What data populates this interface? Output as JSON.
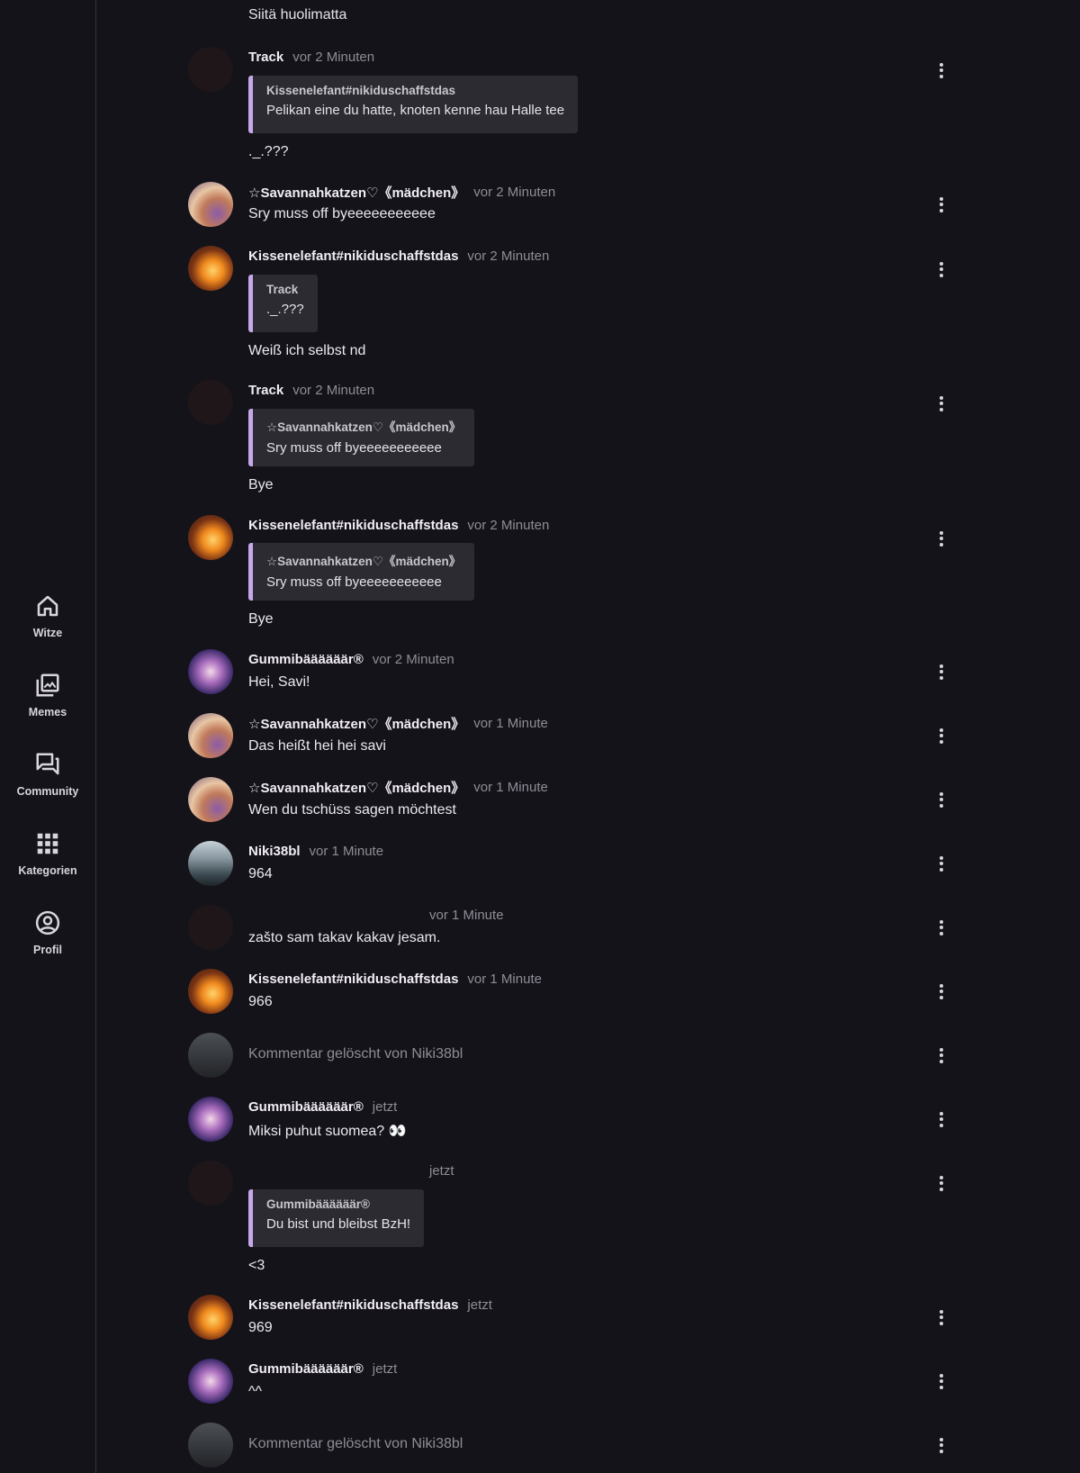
{
  "nav": {
    "items": [
      {
        "label": "Witze",
        "icon": "home-icon"
      },
      {
        "label": "Memes",
        "icon": "photo-library-icon"
      },
      {
        "label": "Community",
        "icon": "forum-icon"
      },
      {
        "label": "Kategorien",
        "icon": "apps-grid-icon"
      },
      {
        "label": "Profil",
        "icon": "account-circle-icon"
      }
    ]
  },
  "feed": {
    "top_fragment": "Siitä huolimatta",
    "comments": [
      {
        "author": "Track",
        "time": "vor 2 Minuten",
        "quote": {
          "author": "Kissenelefant#nikiduschaffstdas",
          "text": "Pelikan eine du hatte, knoten kenne hau Halle tee"
        },
        "text": "._.???"
      },
      {
        "author": "☆Savannahkatzen♡《mädchen》",
        "time": "vor 2 Minuten",
        "text": "Sry muss off byeeeeeeeeeee"
      },
      {
        "author": "Kissenelefant#nikiduschaffstdas",
        "time": "vor 2 Minuten",
        "quote": {
          "author": "Track",
          "text": "._.???"
        },
        "text": "Weiß ich selbst nd"
      },
      {
        "author": "Track",
        "time": "vor 2 Minuten",
        "quote": {
          "author": "☆Savannahkatzen♡《mädchen》",
          "text": "Sry muss off byeeeeeeeeeee"
        },
        "text": "Bye"
      },
      {
        "author": "Kissenelefant#nikiduschaffstdas",
        "time": "vor 2 Minuten",
        "quote": {
          "author": "☆Savannahkatzen♡《mädchen》",
          "text": "Sry muss off byeeeeeeeeeee"
        },
        "text": "Bye"
      },
      {
        "author": "Gummibäääääär®",
        "time": "vor 2 Minuten",
        "text": "Hei, Savi!"
      },
      {
        "author": "☆Savannahkatzen♡《mädchen》",
        "time": "vor 1 Minute",
        "text": "Das heißt hei hei savi"
      },
      {
        "author": "☆Savannahkatzen♡《mädchen》",
        "time": "vor 1 Minute",
        "text": "Wen du tschüss sagen möchtest"
      },
      {
        "author": "Niki38bl",
        "time": "vor 1 Minute",
        "text": "964"
      },
      {
        "author": "",
        "time": "vor 1 Minute",
        "text": "zašto sam takav kakav jesam."
      },
      {
        "author": "Kissenelefant#nikiduschaffstdas",
        "time": "vor 1 Minute",
        "text": "966"
      },
      {
        "deleted_text": "Kommentar gelöscht von Niki38bl"
      },
      {
        "author": "Gummibäääääär®",
        "time": "jetzt",
        "text": "Miksi puhut suomea? 👀"
      },
      {
        "author": "",
        "time": "jetzt",
        "quote": {
          "author": "Gummibäääääär®",
          "text": "Du bist und bleibst BzH!"
        },
        "text": "<3"
      },
      {
        "author": "Kissenelefant#nikiduschaffstdas",
        "time": "jetzt",
        "text": "969"
      },
      {
        "author": "Gummibäääääär®",
        "time": "jetzt",
        "text": "^^"
      },
      {
        "deleted_text": "Kommentar gelöscht von Niki38bl"
      }
    ]
  },
  "colors": {
    "background": "#141319",
    "quote_bar": "#c6a8ea",
    "quote_bg": "#2c2b32",
    "muted_text": "#8f8c96"
  }
}
